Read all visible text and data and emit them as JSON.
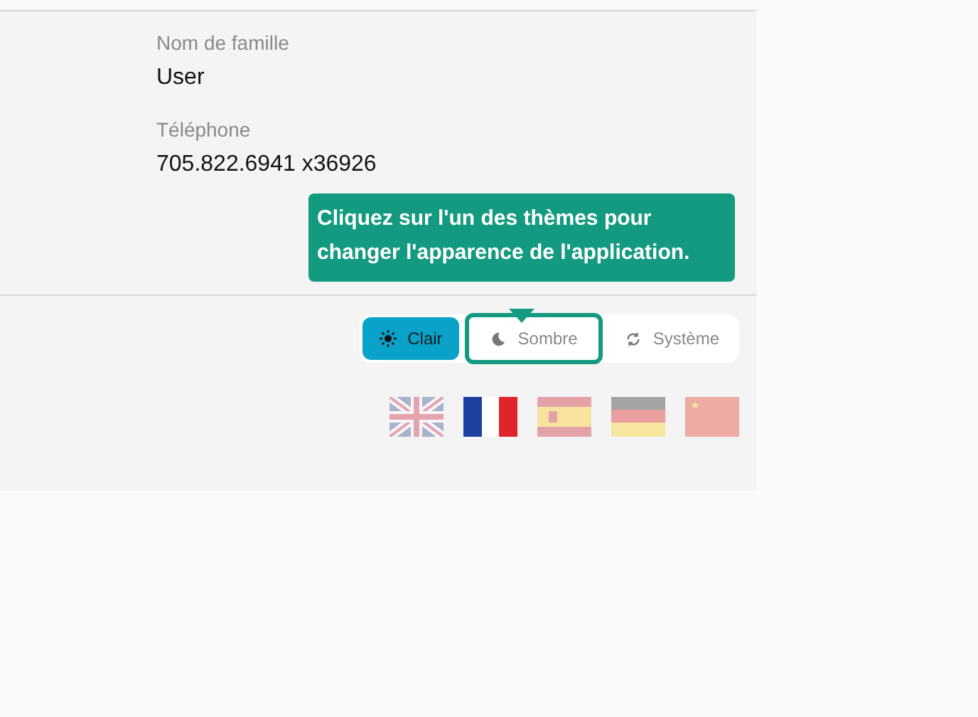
{
  "fields": [
    {
      "label": "Nom de famille",
      "value": "User"
    },
    {
      "label": "Téléphone",
      "value": "705.822.6941 x36926"
    }
  ],
  "tooltip": {
    "text": "Cliquez sur l'un des thèmes pour changer l'apparence de l'application."
  },
  "themes": [
    {
      "kind": "sun",
      "label": "Clair",
      "selected": true,
      "highlighted": false
    },
    {
      "kind": "moon",
      "label": "Sombre",
      "selected": false,
      "highlighted": true
    },
    {
      "kind": "sync",
      "label": "Système",
      "selected": false,
      "highlighted": false
    }
  ],
  "languages": [
    {
      "kind": "uk",
      "selected": false
    },
    {
      "kind": "fr",
      "selected": true
    },
    {
      "kind": "es",
      "selected": false
    },
    {
      "kind": "de",
      "selected": false
    },
    {
      "kind": "cn",
      "selected": false
    }
  ]
}
